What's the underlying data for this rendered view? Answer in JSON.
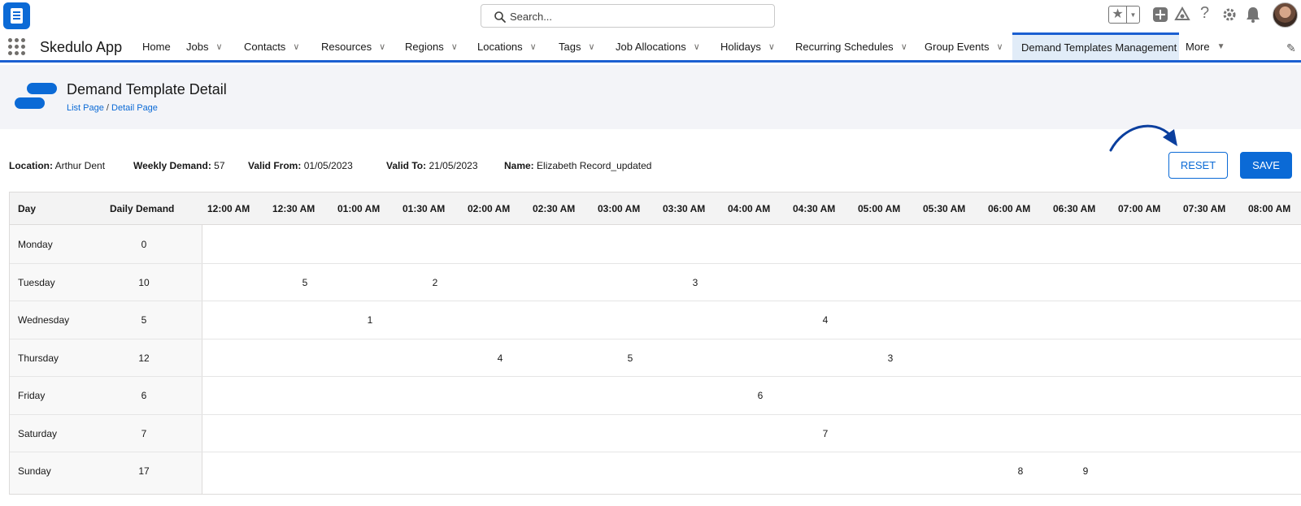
{
  "topbar": {
    "search_placeholder": "Search...",
    "icons": [
      "app-logo",
      "search-icon",
      "favorites-star-icon",
      "favorites-caret-icon",
      "add-icon",
      "trailhead-icon",
      "help-icon",
      "setup-gear-icon",
      "notifications-bell-icon",
      "user-avatar"
    ]
  },
  "nav": {
    "app_name": "Skedulo App",
    "items": [
      {
        "label": "Home",
        "has_menu": false
      },
      {
        "label": "Jobs",
        "has_menu": true
      },
      {
        "label": "Contacts",
        "has_menu": true
      },
      {
        "label": "Resources",
        "has_menu": true
      },
      {
        "label": "Regions",
        "has_menu": true
      },
      {
        "label": "Locations",
        "has_menu": true
      },
      {
        "label": "Tags",
        "has_menu": true
      },
      {
        "label": "Job Allocations",
        "has_menu": true
      },
      {
        "label": "Holidays",
        "has_menu": true
      },
      {
        "label": "Recurring Schedules",
        "has_menu": true
      },
      {
        "label": "Group Events",
        "has_menu": true
      },
      {
        "label": "Demand Templates Management",
        "has_menu": false,
        "active": true
      },
      {
        "label": "More",
        "has_menu": true
      }
    ],
    "accent_color": "#1b5fd1"
  },
  "header": {
    "title": "Demand Template Detail",
    "breadcrumb": [
      "List Page",
      "Detail Page"
    ],
    "breadcrumb_separator": " / "
  },
  "info": {
    "location_label": "Location:",
    "location_value": "Arthur Dent",
    "weekly_demand_label": "Weekly Demand:",
    "weekly_demand_value": "57",
    "valid_from_label": "Valid From:",
    "valid_from_value": "01/05/2023",
    "valid_to_label": "Valid To:",
    "valid_to_value": "21/05/2023",
    "name_label": "Name:",
    "name_value": "Elizabeth Record_updated"
  },
  "buttons": {
    "reset_label": "RESET",
    "save_label": "SAVE",
    "primary_color": "#0b6ad6"
  },
  "grid": {
    "day_header": "Day",
    "daily_demand_header": "Daily Demand",
    "time_slots": [
      "12:00 AM",
      "12:30 AM",
      "01:00 AM",
      "01:30 AM",
      "02:00 AM",
      "02:30 AM",
      "03:00 AM",
      "03:30 AM",
      "04:00 AM",
      "04:30 AM",
      "05:00 AM",
      "05:30 AM",
      "06:00 AM",
      "06:30 AM",
      "07:00 AM",
      "07:30 AM",
      "08:00 AM"
    ],
    "rows": [
      {
        "day": "Monday",
        "daily_demand": "0",
        "slots": {}
      },
      {
        "day": "Tuesday",
        "daily_demand": "10",
        "slots": {
          "12:30 AM": "5",
          "01:30 AM": "2",
          "03:30 AM": "3"
        }
      },
      {
        "day": "Wednesday",
        "daily_demand": "5",
        "slots": {
          "01:00 AM": "1",
          "04:30 AM": "4"
        }
      },
      {
        "day": "Thursday",
        "daily_demand": "12",
        "slots": {
          "02:00 AM": "4",
          "03:00 AM": "5",
          "05:00 AM": "3"
        }
      },
      {
        "day": "Friday",
        "daily_demand": "6",
        "slots": {
          "04:00 AM": "6"
        }
      },
      {
        "day": "Saturday",
        "daily_demand": "7",
        "slots": {
          "04:30 AM": "7"
        }
      },
      {
        "day": "Sunday",
        "daily_demand": "17",
        "slots": {
          "06:00 AM": "8",
          "06:30 AM": "9"
        }
      }
    ]
  }
}
